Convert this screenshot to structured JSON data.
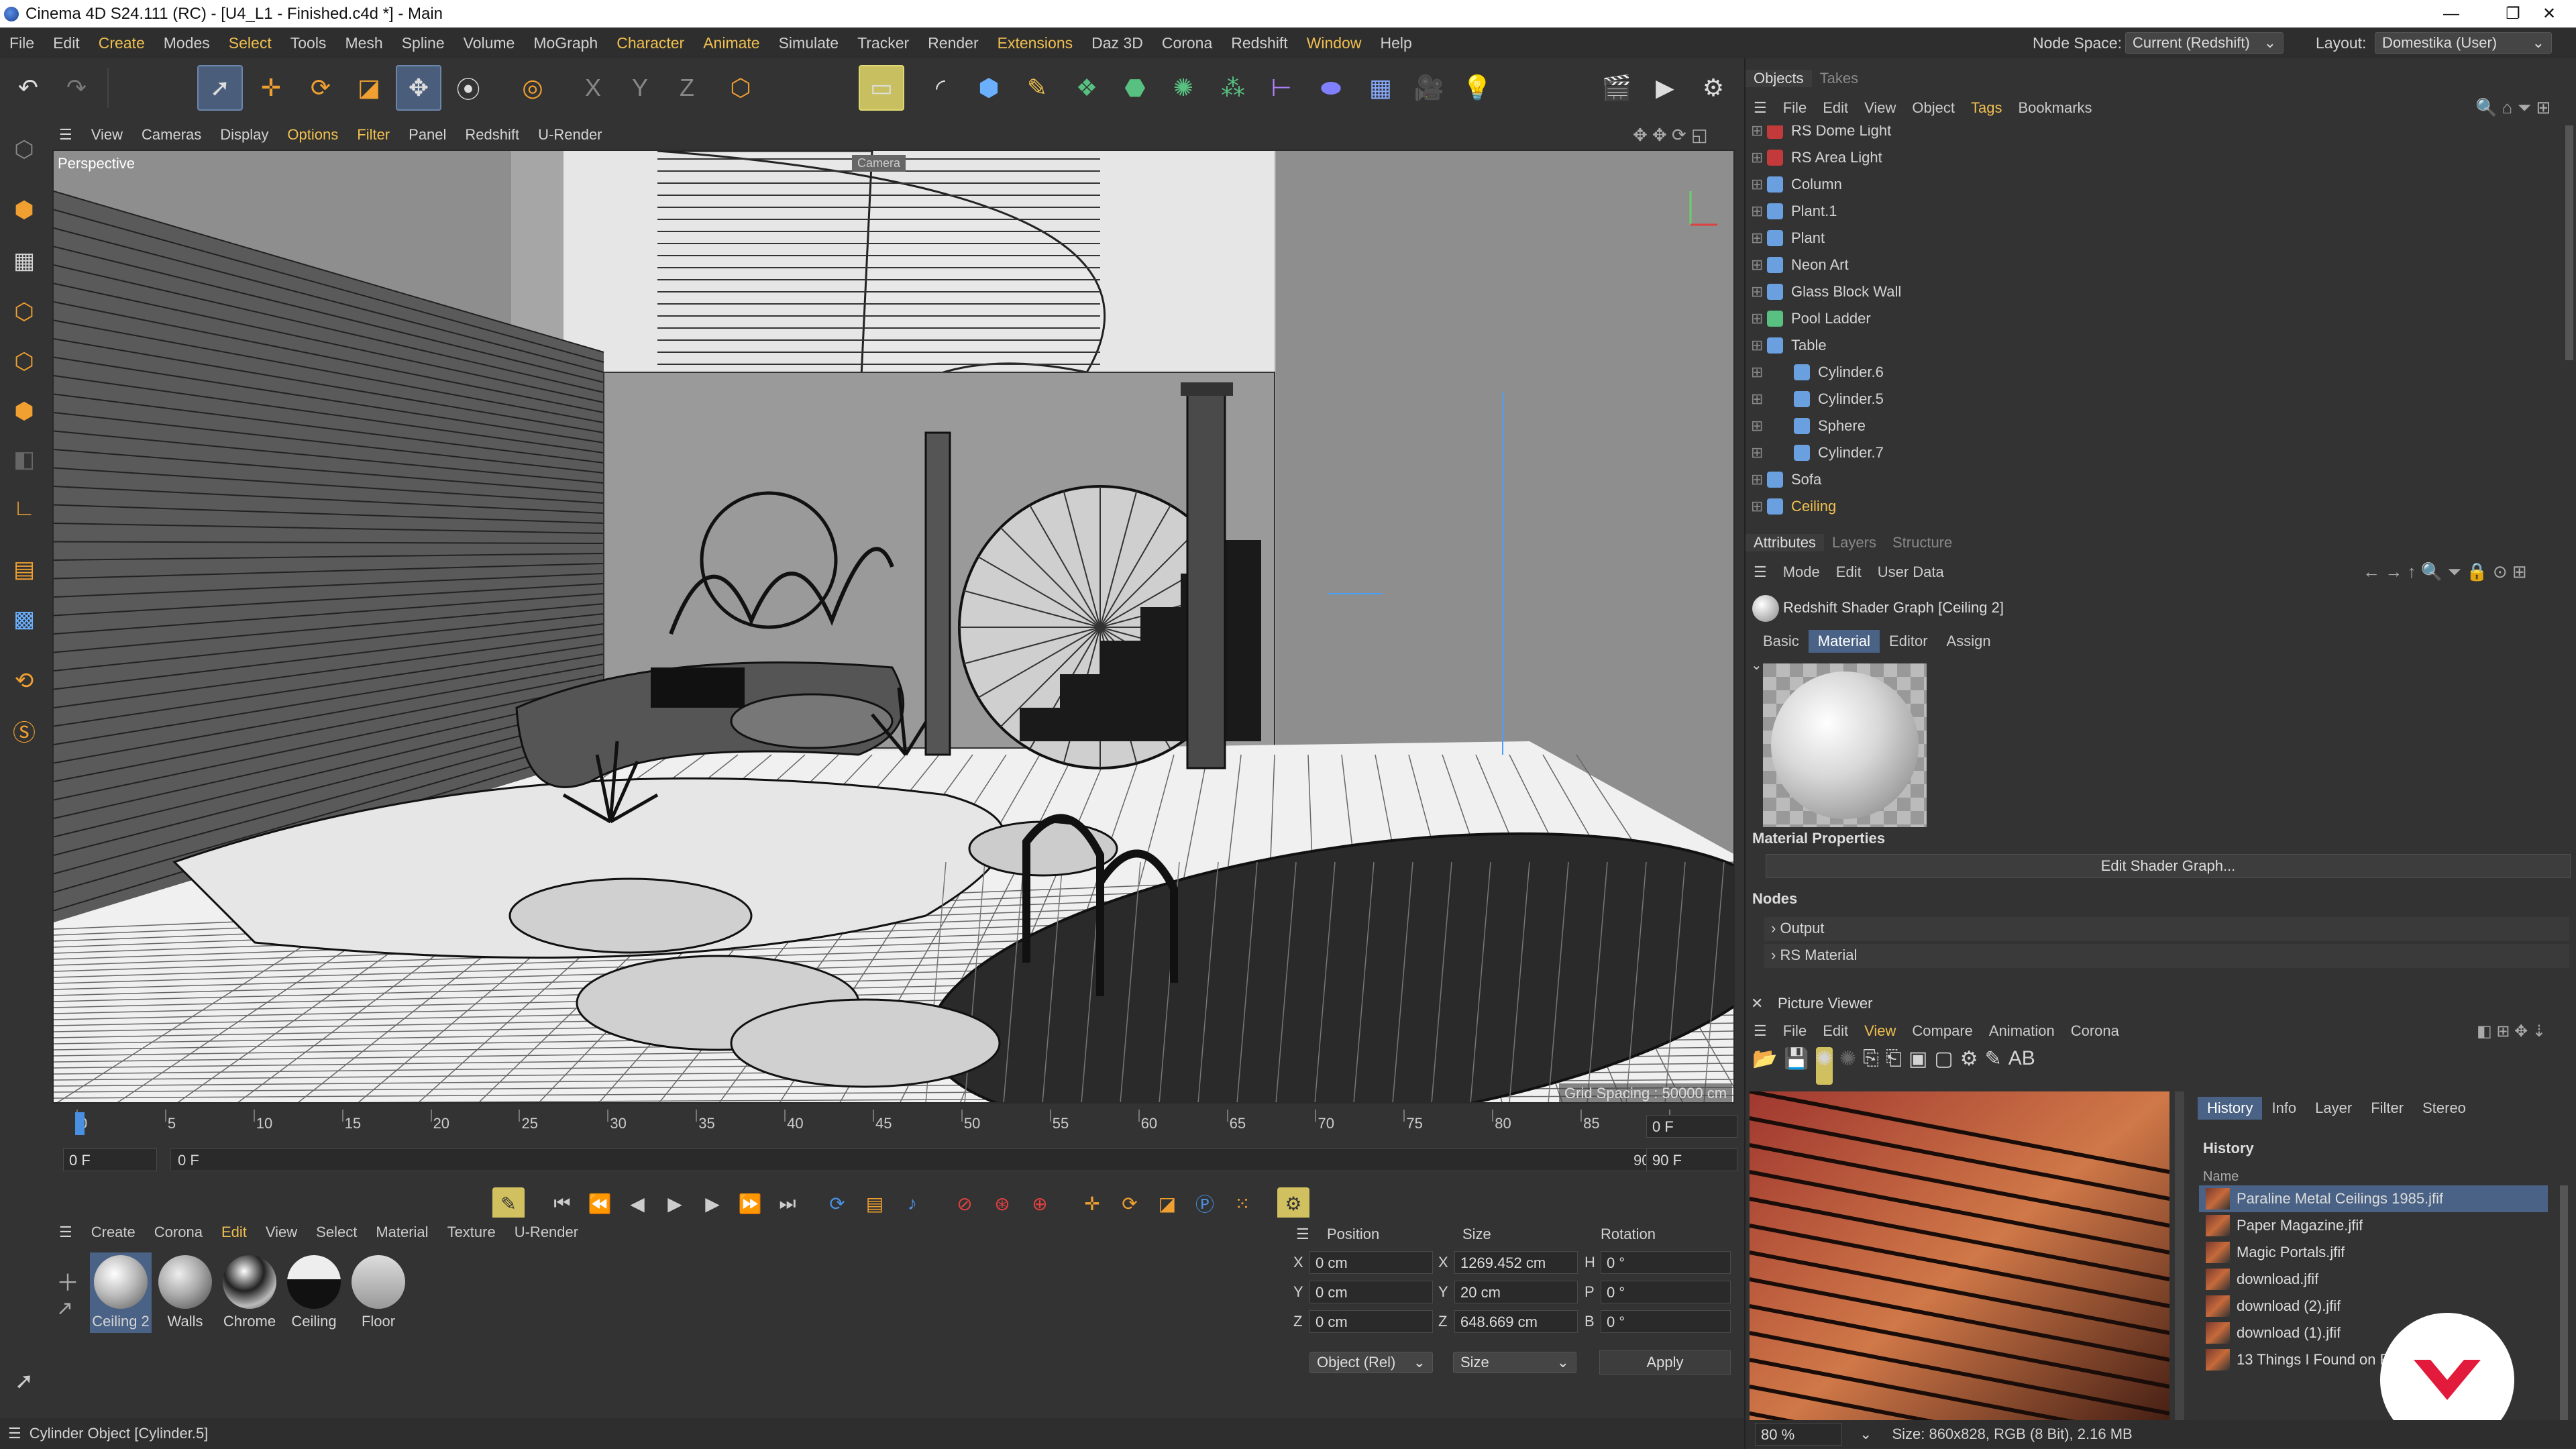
{
  "window": {
    "title": "Cinema 4D S24.111 (RC) - [U4_L1 - Finished.c4d *] - Main"
  },
  "menubar": {
    "items": [
      "File",
      "Edit",
      "Create",
      "Modes",
      "Select",
      "Tools",
      "Mesh",
      "Spline",
      "Volume",
      "MoGraph",
      "Character",
      "Animate",
      "Simulate",
      "Tracker",
      "Render",
      "Extensions",
      "Daz 3D",
      "Corona",
      "Redshift",
      "Window",
      "Help"
    ],
    "node_space_label": "Node Space:",
    "node_space_value": "Current (Redshift)",
    "layout_label": "Layout:",
    "layout_value": "Domestika (User)"
  },
  "viewport": {
    "menu": [
      "View",
      "Cameras",
      "Display",
      "Options",
      "Filter",
      "Panel",
      "Redshift",
      "U-Render"
    ],
    "name": "Perspective",
    "camera_label": "Camera",
    "grid_spacing": "Grid Spacing : 50000 cm"
  },
  "timeline": {
    "ticks": [
      "0",
      "5",
      "10",
      "15",
      "20",
      "25",
      "30",
      "35",
      "40",
      "45",
      "50",
      "55",
      "60",
      "65",
      "70",
      "75",
      "80",
      "85",
      "90"
    ],
    "current_frame": "0 F",
    "start_field": "0 F",
    "start_frame": "0 F",
    "end_frame": "90 F",
    "end_field": "90 F",
    "end_field2": "90 F"
  },
  "materials": {
    "menu": [
      "Create",
      "Corona",
      "Edit",
      "View",
      "Select",
      "Material",
      "Texture",
      "U-Render"
    ],
    "items": [
      "Ceiling 2",
      "Walls",
      "Chrome",
      "Ceiling",
      "Floor"
    ]
  },
  "coords": {
    "headers": [
      "Position",
      "Size",
      "Rotation"
    ],
    "rows": [
      {
        "axis": "X",
        "pos": "0 cm",
        "size_axis": "X",
        "size": "1269.452 cm",
        "rot_axis": "H",
        "rot": "0 °"
      },
      {
        "axis": "Y",
        "pos": "0 cm",
        "size_axis": "Y",
        "size": "20 cm",
        "rot_axis": "P",
        "rot": "0 °"
      },
      {
        "axis": "Z",
        "pos": "0 cm",
        "size_axis": "Z",
        "size": "648.669 cm",
        "rot_axis": "B",
        "rot": "0 °"
      }
    ],
    "mode": "Object (Rel)",
    "size_mode": "Size",
    "apply": "Apply"
  },
  "status": {
    "text": "Cylinder Object [Cylinder.5]"
  },
  "objects": {
    "tabs": [
      "Objects",
      "Takes"
    ],
    "menu": [
      "File",
      "Edit",
      "View",
      "Object",
      "Tags",
      "Bookmarks"
    ],
    "rows": [
      {
        "name": "RS Dome Light",
        "color": "#c23a3a",
        "check": "✓",
        "level": 0
      },
      {
        "name": "RS Area Light",
        "color": "#c23a3a",
        "check": "✓",
        "level": 0
      },
      {
        "name": "Column",
        "color": "#6aa0e0",
        "check": "",
        "level": 0
      },
      {
        "name": "Plant.1",
        "color": "#6aa0e0",
        "check": "",
        "level": 0
      },
      {
        "name": "Plant",
        "color": "#6aa0e0",
        "check": "",
        "level": 0
      },
      {
        "name": "Neon Art",
        "color": "#6aa0e0",
        "check": "",
        "level": 0
      },
      {
        "name": "Glass Block Wall",
        "color": "#6aa0e0",
        "check": "",
        "level": 0
      },
      {
        "name": "Pool Ladder",
        "color": "#58c080",
        "check": "✓",
        "level": 0
      },
      {
        "name": "Table",
        "color": "#6aa0e0",
        "check": "",
        "level": 0
      },
      {
        "name": "Cylinder.6",
        "color": "#6aa0e0",
        "check": "✓",
        "level": 1
      },
      {
        "name": "Cylinder.5",
        "color": "#6aa0e0",
        "check": "✓",
        "level": 1
      },
      {
        "name": "Sphere",
        "color": "#6aa0e0",
        "check": "✓",
        "level": 1
      },
      {
        "name": "Cylinder.7",
        "color": "#6aa0e0",
        "check": "✓",
        "level": 1
      },
      {
        "name": "Sofa",
        "color": "#6aa0e0",
        "check": "",
        "level": 0
      },
      {
        "name": "Ceiling",
        "color": "#6aa0e0",
        "check": "",
        "level": 0
      }
    ]
  },
  "attributes": {
    "tabs": [
      "Attributes",
      "Layers",
      "Structure"
    ],
    "menu": [
      "Mode",
      "Edit",
      "User Data"
    ],
    "object_title": "Redshift Shader Graph [Ceiling 2]",
    "subtabs": [
      "Basic",
      "Material",
      "Editor",
      "Assign"
    ],
    "material_properties": "Material Properties",
    "edit_shader": "Edit Shader Graph...",
    "nodes_header": "Nodes",
    "nodes": [
      "Output",
      "RS Material"
    ]
  },
  "picture_viewer": {
    "title": "Picture Viewer",
    "menu": [
      "File",
      "Edit",
      "View",
      "Compare",
      "Animation",
      "Corona"
    ],
    "tabs": [
      "History",
      "Info",
      "Layer",
      "Filter",
      "Stereo"
    ],
    "history_header": "History",
    "name_col": "Name",
    "history": [
      "Paraline Metal Ceilings 1985.jfif",
      "Paper Magazine.jfif",
      "Magic Portals.jfif",
      "download.jfif",
      "download (2).jfif",
      "download (1).jfif",
      "13 Things I Found on Pinterest Today (Vo"
    ],
    "zoom": "80 %",
    "size_info": "Size: 860x828, RGB (8 Bit), 2.16 MB"
  },
  "colors": {
    "accent": "#4a6285",
    "highlight": "#f0c050"
  }
}
